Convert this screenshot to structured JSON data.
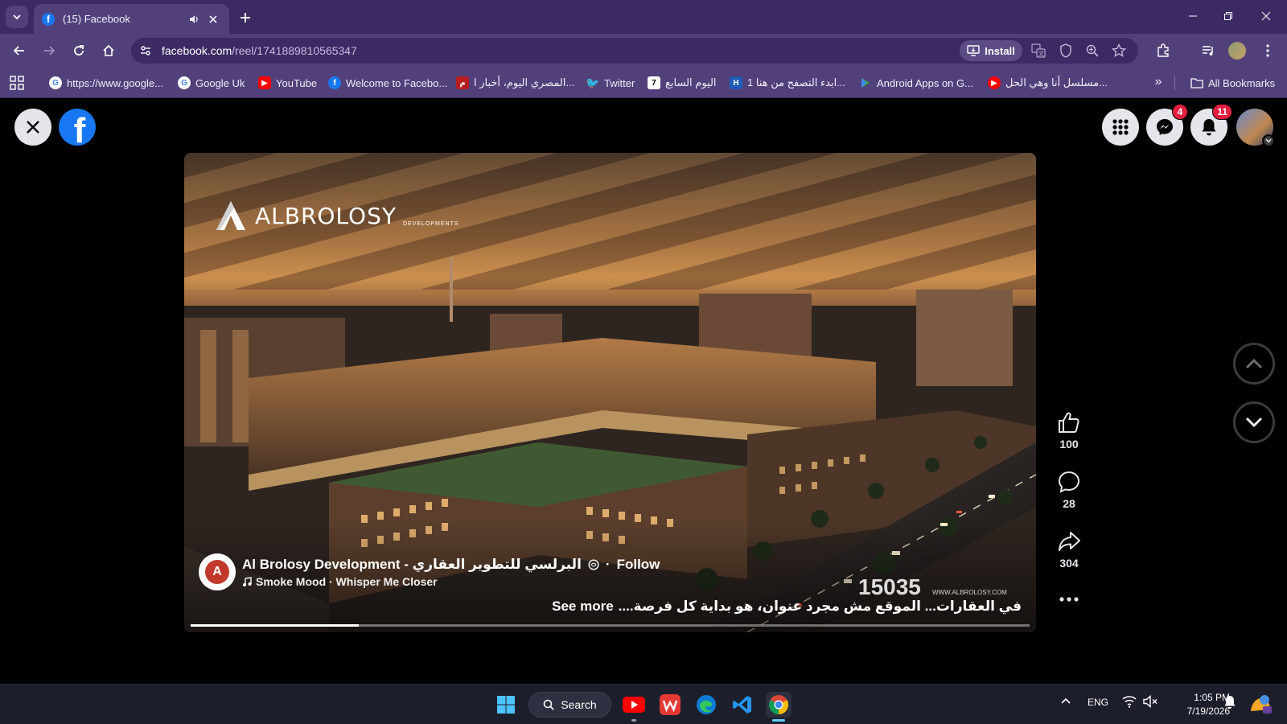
{
  "browser": {
    "tab": {
      "title": "(15) Facebook"
    },
    "address": {
      "host": "facebook.com",
      "path": "/reel/1741889810565347"
    },
    "install_label": "Install",
    "bookmarks": [
      {
        "label": "https://www.google...",
        "icon": "google-icon"
      },
      {
        "label": "Google Uk",
        "icon": "google-icon"
      },
      {
        "label": "YouTube",
        "icon": "youtube-icon"
      },
      {
        "label": "Welcome to Facebo...",
        "icon": "facebook-icon"
      },
      {
        "label": "المصري اليوم، أخبار ا...",
        "icon": "almasry-icon"
      },
      {
        "label": "Twitter",
        "icon": "twitter-icon"
      },
      {
        "label": "اليوم السابع",
        "icon": "youm7-icon"
      },
      {
        "label": "ابدء التصفح من هنا 1...",
        "icon": "bookmark-page-icon"
      },
      {
        "label": "Android Apps on G...",
        "icon": "google-play-icon"
      },
      {
        "label": "مسلسل أنا وهي الحل...",
        "icon": "youtube-icon"
      }
    ],
    "all_bookmarks": "All Bookmarks"
  },
  "facebook": {
    "messenger_badge": "4",
    "notifications_badge": "11",
    "reel": {
      "brand_name": "ALBROLOSY",
      "brand_sub": "DEVELOPMENTS",
      "owner_name": "Al Brolosy Development - البرلسي للتطوير العقاري",
      "follow_label": "Follow",
      "audio": "Smoke Mood · Whisper Me Closer",
      "watermark_number": "15035",
      "watermark_url": "WWW.ALBROLOSY.COM",
      "caption": "في العقارات... الموقع مش مجرد عنوان، هو بداية كل فرصة....",
      "see_more": "See more",
      "progress": 0.2
    },
    "actions": {
      "likes": "100",
      "comments": "28",
      "shares": "304"
    }
  },
  "taskbar": {
    "search_label": "Search",
    "language": "ENG",
    "time": "1:05 PM",
    "date": "7/19/2026"
  },
  "colors": {
    "chrome_frame": "#3d2a64",
    "chrome_toolbar": "#51407a",
    "facebook_blue": "#1877f2",
    "badge_red": "#e41e3f"
  }
}
